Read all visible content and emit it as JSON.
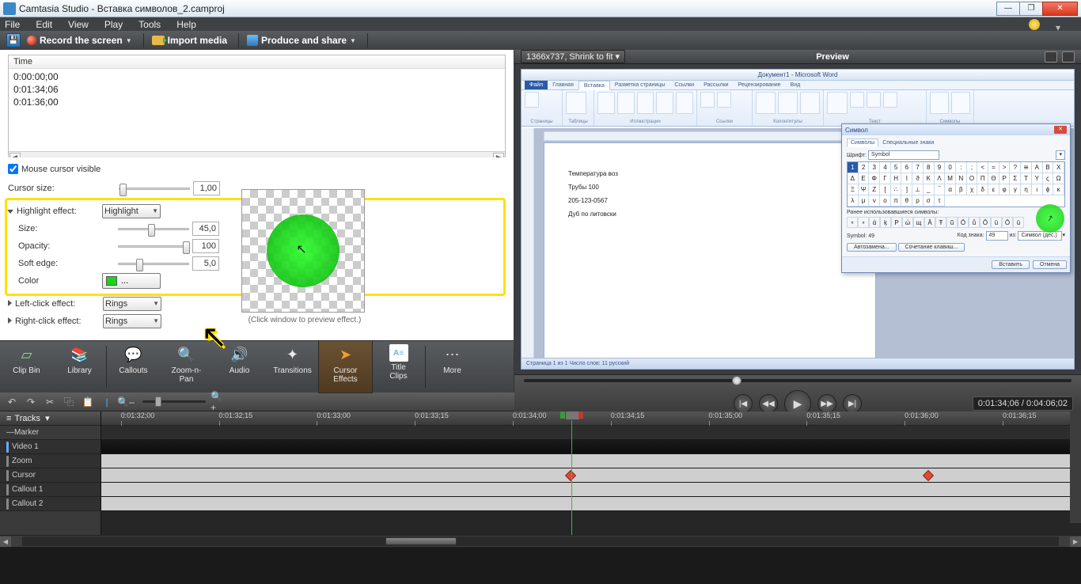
{
  "title": "Camtasia Studio - Вставка символов_2.camproj",
  "menu": [
    "File",
    "Edit",
    "View",
    "Play",
    "Tools",
    "Help"
  ],
  "toolbar": {
    "record": "Record the screen",
    "import": "Import media",
    "produce": "Produce and share"
  },
  "time_header": "Time",
  "time_rows": [
    "0:00:00;00",
    "0:01:34;06",
    "0:01:36;00"
  ],
  "mouse_visible": "Mouse cursor visible",
  "cursor_size": "Cursor size:",
  "cursor_size_val": "1,00",
  "highlight_effect": "Highlight effect:",
  "highlight_val": "Highlight",
  "size": "Size:",
  "size_val": "45,0",
  "opacity": "Opacity:",
  "opacity_val": "100",
  "softedge": "Soft edge:",
  "softedge_val": "5,0",
  "color": "Color",
  "color_btn": "...",
  "leftclick": "Left-click effect:",
  "leftclick_val": "Rings",
  "rightclick": "Right-click effect:",
  "rightclick_val": "Rings",
  "preview_cap": "(Click window to preview effect.)",
  "tabs": {
    "clipbin": "Clip Bin",
    "library": "Library",
    "callouts": "Callouts",
    "zoom": "Zoom-n-",
    "zoom2": "Pan",
    "audio": "Audio",
    "transitions": "Transitions",
    "cursor": "Cursor",
    "cursor2": "Effects",
    "title": "Title",
    "title2": "Clips",
    "more": "More"
  },
  "preview_title": "Preview",
  "preview_zoom": "1366x737, Shrink to fit",
  "word": {
    "title": "Документ1 - Microsoft Word",
    "tabs": [
      "Файл",
      "Главная",
      "Вставка",
      "Разметка страницы",
      "Ссылки",
      "Рассылки",
      "Рецензирование",
      "Вид"
    ],
    "groups": [
      "Страницы",
      "Таблицы",
      "Иллюстрации",
      "Ссылки",
      "Колонтитулы",
      "Текст",
      "Символы"
    ],
    "lines": [
      "Температура воз",
      "Трубы 100",
      "205-123-0567",
      "Дуб по литовски"
    ],
    "status": "Страница 1 из 1   Число слов: 11   русский"
  },
  "symbol_dialog": {
    "title": "Символ",
    "tab1": "Символы",
    "tab2": "Специальные знаки",
    "font_lbl": "Шрифт:",
    "font_val": "Symbol",
    "chars": [
      "1",
      "2",
      "3",
      "4",
      "5",
      "6",
      "7",
      "8",
      "9",
      "0",
      ":",
      ";",
      "<",
      "=",
      ">",
      "?",
      "≅",
      "Α",
      "Β",
      "Χ",
      "Δ",
      "Ε",
      "Φ",
      "Γ",
      "Η",
      "Ι",
      "ϑ",
      "Κ",
      "Λ",
      "Μ",
      "Ν",
      "Ο",
      "Π",
      "Θ",
      "Ρ",
      "Σ",
      "Τ",
      "Υ",
      "ς",
      "Ω",
      "Ξ",
      "Ψ",
      "Ζ",
      "[",
      "∴",
      "]",
      "⊥",
      "_",
      "‾",
      "α",
      "β",
      "χ",
      "δ",
      "ε",
      "φ",
      "γ",
      "η",
      "ι",
      "ϕ",
      "κ",
      "λ",
      "μ",
      "ν",
      "ο",
      "π",
      "θ",
      "ρ",
      "σ",
      "τ"
    ],
    "recent_lbl": "Ранее использовавшиеся символы:",
    "recent": [
      "∘",
      "∘",
      "ά",
      "ķ",
      "Ρ",
      "ώ",
      "щ",
      "Ā",
      "Ŧ",
      "ũ",
      "Ŏ",
      "ů",
      "Ŏ",
      "ū",
      "Ŏ",
      "ū"
    ],
    "code_lbl": "Код знака:",
    "code_val": "49",
    "from_lbl": "из:",
    "from_val": "Символ (дес.)",
    "name_lbl": "Symbol: 49",
    "auto": "Автозамена...",
    "shortcut": "Сочетание клавиш...",
    "insert": "Вставить",
    "close": "Отмена"
  },
  "playtime": "0:01:34;06 / 0:04:06;02",
  "tracks_hdr": "Tracks",
  "track_lbls": [
    "Marker",
    "Video 1",
    "Zoom",
    "Cursor",
    "Callout 1",
    "Callout 2"
  ],
  "ruler": [
    "0:01:32;00",
    "0:01:32;15",
    "0:01:33;00",
    "0:01:33;15",
    "0:01:34;00",
    "0:01:34;15",
    "0:01:35;00",
    "0:01:35;15",
    "0:01:36;00",
    "0:01:36;15"
  ]
}
